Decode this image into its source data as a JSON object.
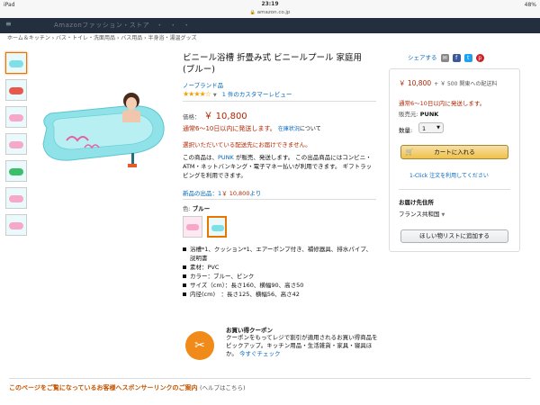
{
  "status": {
    "left": "iPad",
    "time": "23:19",
    "right": "48%"
  },
  "url": "amazon.co.jp",
  "nav": {
    "text": "Amazonファッション・ストア　・　・　・"
  },
  "breadcrumb": "ホーム＆キッチン › バス・トイレ・洗面用品 › バス用品 › 半身浴・湯温グッズ",
  "product": {
    "title": "ビニール浴槽 折畳み式 ビニールプール 家庭用 (ブルー)",
    "brand": "ノーブランド品",
    "review_count": "1 件のカスタマーレビュー",
    "price_label": "価格：",
    "price": "￥ 10,800",
    "shipping": "通常6～10日以内に発送します。",
    "shipping_link": "在庫状況",
    "shipping_suffix": "について",
    "no_destination": "選択いただいている配送先にお届けできません。",
    "desc_1": "この商品は、",
    "desc_seller": "PUNK",
    "desc_2": " が販売、発送します。 この出品商品にはコンビニ・ATM・ネットバンキング・電子マネー払いが利用できます。 ギフトラッピングを利用できます。",
    "new_items": "新品の出品：1",
    "new_price": "￥ 10,800",
    "new_items_suffix": "より",
    "color_label": "色:",
    "color_value": "ブルー"
  },
  "bullets": [
    "浴槽*1、クッション*1、エアーポンプ付き、補修器具、排水パイプ、説明書",
    "素材：PVC",
    "カラー：ブルー、ピンク",
    "サイズ（cm）：長さ160、横幅90、高さ50",
    "内径(cm)　：長さ125、横幅56、高さ42"
  ],
  "coupon": {
    "title": "お買い得クーポン",
    "desc": "クーポンをもってレジで割引が適用されるお買い得商品をピックアップ。キッチン用品・生活雑貨・家具・寝具ほか。",
    "link": "今すぐチェック"
  },
  "share": {
    "label": "シェアする"
  },
  "buybox": {
    "price": "￥ 10,800",
    "plus": "+ ￥ 500 関東への配送料",
    "shipping": "通常6～10日以内に発送します。",
    "seller_label": "販売元:",
    "seller": "PUNK",
    "qty_label": "数量:",
    "qty_value": "1",
    "cart": "カートに入れる",
    "oneclick": "1-Click 注文を利用してください",
    "dest_title": "お届け先住所",
    "dest_value": "フランス共和国",
    "wishlist": "ほしい物リストに追加する"
  },
  "sponsor": {
    "text": "このページをご覧になっているお客様へスポンサーリンクのご案内",
    "help": "(ヘルプはこちら)"
  },
  "colors": {
    "accent": "#e77600",
    "price": "#b12704",
    "link": "#0066c0",
    "nav": "#232f3e"
  }
}
